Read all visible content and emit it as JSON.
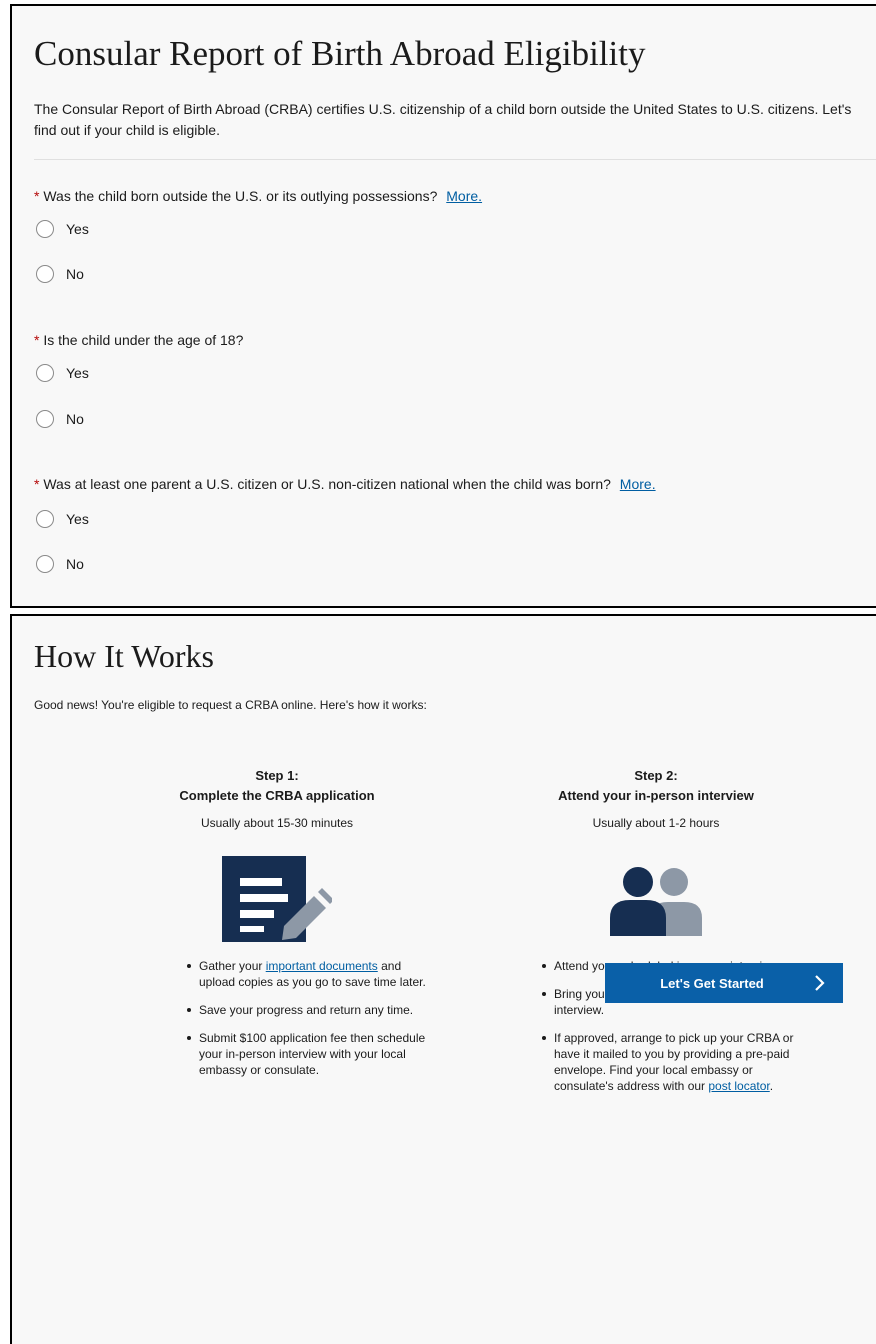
{
  "eligibility": {
    "title": "Consular Report of Birth Abroad Eligibility",
    "intro": "The Consular Report of Birth Abroad (CRBA) certifies U.S. citizenship of a child born outside the United States to U.S. citizens. Let's find out if your child is eligible.",
    "required_marker": "*",
    "questions": [
      {
        "text": "Was the child born outside the U.S. or its outlying possessions?",
        "more": "More.",
        "options": [
          "Yes",
          "No"
        ]
      },
      {
        "text": "Is the child under the age of 18?",
        "more": "",
        "options": [
          "Yes",
          "No"
        ]
      },
      {
        "text": "Was at least one parent a U.S. citizen or U.S. non-citizen national when the child was born?",
        "more": "More.",
        "options": [
          "Yes",
          "No"
        ]
      }
    ]
  },
  "how_it_works": {
    "title": "How It Works",
    "intro": "Good news!  You're eligible to request a CRBA online.  Here's how it works:",
    "steps": [
      {
        "heading_line1": "Step 1:",
        "heading_line2": "Complete the CRBA application",
        "time": "Usually about 15-30 minutes",
        "icon": "document-edit-icon",
        "bullets": [
          {
            "pre": "Gather your ",
            "link": "important documents",
            "post": " and upload copies as you go to save time later."
          },
          {
            "pre": "Save your progress and return any time.",
            "link": "",
            "post": ""
          },
          {
            "pre": "Submit $100 application fee then schedule your in-person interview with your local embassy or consulate.",
            "link": "",
            "post": ""
          }
        ]
      },
      {
        "heading_line1": "Step 2:",
        "heading_line2": "Attend your in-person interview",
        "time": "Usually about 1-2 hours",
        "icon": "people-icon",
        "bullets": [
          {
            "pre": "Attend your scheduled in-person interview.",
            "link": "",
            "post": ""
          },
          {
            "pre": "Bring your original documents to your interview.",
            "link": "",
            "post": ""
          },
          {
            "pre": "If approved, arrange to pick up your CRBA or have it mailed to you by providing a pre-paid envelope. Find your local embassy or consulate's address with our ",
            "link": "post locator",
            "post": "."
          }
        ]
      }
    ],
    "cta_label": "Let's Get Started"
  },
  "colors": {
    "accent": "#0a60a8",
    "link": "#005ea2",
    "required": "#b50909",
    "icon_dark": "#162e51",
    "icon_gray": "#8d98a6",
    "panel_bg": "#f8f8f8"
  }
}
